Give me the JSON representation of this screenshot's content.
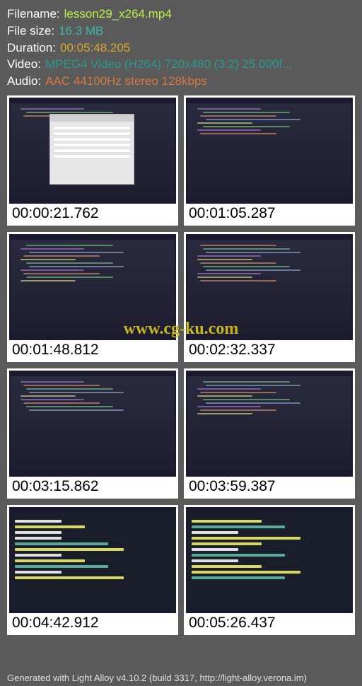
{
  "header": {
    "filename_label": "Filename:",
    "filename_value": "lesson29_x264.mp4",
    "filesize_label": "File size:",
    "filesize_value": "16.3 MB",
    "duration_label": "Duration:",
    "duration_value": "00:05:48.205",
    "video_label": "Video:",
    "video_value": "MPEG4 Video (H264) 720x480 (3:2) 25.000f...",
    "audio_label": "Audio:",
    "audio_value": "AAC 44100Hz stereo 128kbps"
  },
  "thumbnails": [
    {
      "timestamp": "00:00:21.762",
      "type": "dialog"
    },
    {
      "timestamp": "00:01:05.287",
      "type": "code"
    },
    {
      "timestamp": "00:01:48.812",
      "type": "code"
    },
    {
      "timestamp": "00:02:32.337",
      "type": "code"
    },
    {
      "timestamp": "00:03:15.862",
      "type": "code"
    },
    {
      "timestamp": "00:03:59.387",
      "type": "code"
    },
    {
      "timestamp": "00:04:42.912",
      "type": "terminal"
    },
    {
      "timestamp": "00:05:26.437",
      "type": "terminal"
    }
  ],
  "watermark": "www.cg-ku.com",
  "footer": "Generated with Light Alloy v4.10.2 (build 3317, http://light-alloy.verona.im)"
}
